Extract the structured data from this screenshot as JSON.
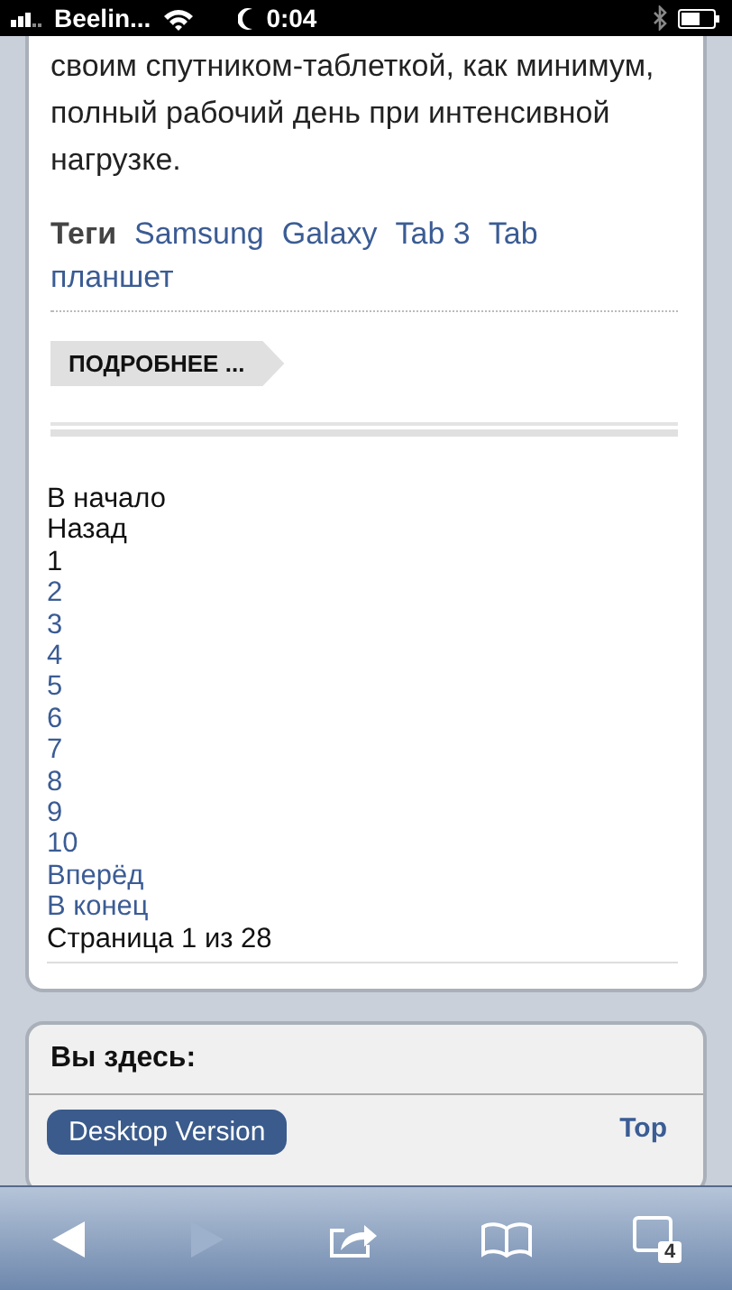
{
  "status_bar": {
    "carrier": "Beelin...",
    "time": "0:04"
  },
  "article": {
    "text_lines": [
      "своим спутником-таблеткой, как минимум,",
      "полный рабочий день при интенсивной",
      "нагрузке."
    ],
    "tags_label": "Теги",
    "tags": [
      "Samsung",
      "Galaxy",
      "Tab 3",
      "Tab",
      "планшет"
    ],
    "more_button": "ПОДРОБНЕЕ ..."
  },
  "pagination": [
    {
      "label": "В начало",
      "kind": "text"
    },
    {
      "label": "Назад",
      "kind": "text"
    },
    {
      "label": "1",
      "kind": "text"
    },
    {
      "label": "2",
      "kind": "link"
    },
    {
      "label": "3",
      "kind": "link"
    },
    {
      "label": "4",
      "kind": "link"
    },
    {
      "label": "5",
      "kind": "link"
    },
    {
      "label": "6",
      "kind": "link"
    },
    {
      "label": "7",
      "kind": "link"
    },
    {
      "label": "8",
      "kind": "link"
    },
    {
      "label": "9",
      "kind": "link"
    },
    {
      "label": "10",
      "kind": "link"
    },
    {
      "label": "Вперёд",
      "kind": "link"
    },
    {
      "label": "В конец",
      "kind": "link"
    }
  ],
  "page_info": "Страница 1 из 28",
  "breadcrumb": {
    "title": "Вы здесь:"
  },
  "footer": {
    "desktop_button": "Desktop Version",
    "top_link": "Top"
  },
  "toolbar": {
    "back_disabled": false,
    "forward_disabled": true,
    "tab_count": "4"
  }
}
